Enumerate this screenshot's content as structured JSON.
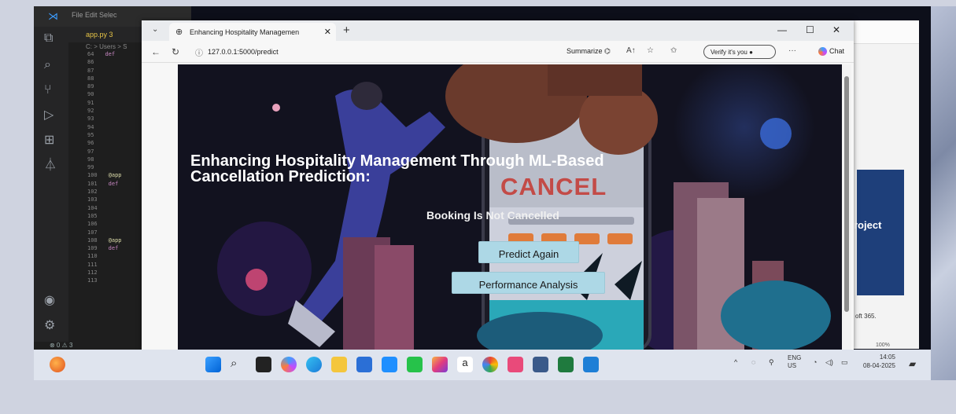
{
  "vscode": {
    "menu": "File  Edit  Selec",
    "tab": "app.py  3",
    "breadcrumb": "C: > Users > S",
    "lines": [
      {
        "n": "64",
        "code": "def"
      },
      {
        "n": "86",
        "code": ""
      },
      {
        "n": "87",
        "code": ""
      },
      {
        "n": "88",
        "code": ""
      },
      {
        "n": "89",
        "code": ""
      },
      {
        "n": "90",
        "code": ""
      },
      {
        "n": "91",
        "code": ""
      },
      {
        "n": "92",
        "code": ""
      },
      {
        "n": "93",
        "code": ""
      },
      {
        "n": "94",
        "code": ""
      },
      {
        "n": "95",
        "code": ""
      },
      {
        "n": "96",
        "code": ""
      },
      {
        "n": "97",
        "code": ""
      },
      {
        "n": "98",
        "code": ""
      },
      {
        "n": "99",
        "code": ""
      },
      {
        "n": "100",
        "code": "@app"
      },
      {
        "n": "101",
        "code": "def"
      },
      {
        "n": "102",
        "code": ""
      },
      {
        "n": "103",
        "code": ""
      },
      {
        "n": "104",
        "code": ""
      },
      {
        "n": "105",
        "code": ""
      },
      {
        "n": "106",
        "code": ""
      },
      {
        "n": "107",
        "code": ""
      },
      {
        "n": "108",
        "code": "@app"
      },
      {
        "n": "109",
        "code": "def"
      },
      {
        "n": "110",
        "code": ""
      },
      {
        "n": "111",
        "code": ""
      },
      {
        "n": "112",
        "code": ""
      },
      {
        "n": "113",
        "code": ""
      }
    ],
    "status": "⊗ 0 ⚠ 3"
  },
  "browser": {
    "tab_title": "Enhancing Hospitality Managemen",
    "url": "127.0.0.1:5000/predict",
    "summarize": "Summarize",
    "verify": "Verify it's you",
    "chat": "Chat"
  },
  "page": {
    "title_line1": "Enhancing Hospitality Management Through ML-Based",
    "title_line2": "Cancellation Prediction:",
    "result": "Booking Is Not Cancelled",
    "predict_again": "Predict Again",
    "performance_analysis": "Performance Analysis",
    "illustration_text": "CANCEL"
  },
  "office": {
    "slide_text": "roject",
    "footer": "oft 365.",
    "zoom": "100%"
  },
  "taskbar": {
    "lang1": "ENG",
    "lang2": "US",
    "time": "14:05",
    "date": "08-04-2025"
  }
}
